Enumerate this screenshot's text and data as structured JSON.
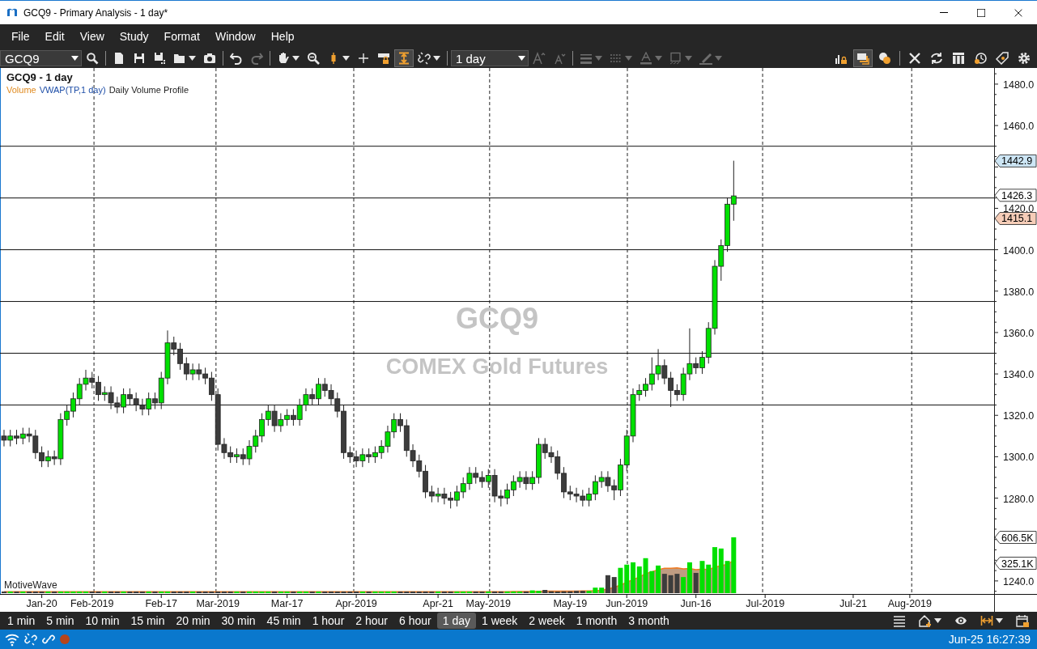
{
  "window": {
    "title": "GCQ9 - Primary Analysis - 1 day*"
  },
  "menu": [
    "File",
    "Edit",
    "View",
    "Study",
    "Format",
    "Window",
    "Help"
  ],
  "toolbar": {
    "left": [
      {
        "kind": "combo",
        "value": "GCQ9"
      },
      {
        "kind": "button",
        "selected": false,
        "disabled": false,
        "dropdown": false
      },
      {
        "kind": "separator"
      },
      {
        "kind": "button",
        "selected": false,
        "disabled": false,
        "dropdown": false
      },
      {
        "kind": "button",
        "selected": false,
        "disabled": false,
        "dropdown": false
      },
      {
        "kind": "button",
        "selected": false,
        "disabled": false,
        "dropdown": false
      },
      {
        "kind": "button",
        "selected": false,
        "disabled": false,
        "dropdown": true
      },
      {
        "kind": "button",
        "selected": false,
        "disabled": false,
        "dropdown": false
      },
      {
        "kind": "separator"
      },
      {
        "kind": "button",
        "selected": false,
        "disabled": false,
        "dropdown": false
      },
      {
        "kind": "button",
        "selected": false,
        "disabled": true,
        "dropdown": false
      },
      {
        "kind": "separator"
      },
      {
        "kind": "button",
        "selected": false,
        "disabled": false,
        "dropdown": true
      },
      {
        "kind": "button",
        "selected": false,
        "disabled": false,
        "dropdown": false
      },
      {
        "kind": "button",
        "selected": false,
        "disabled": false,
        "dropdown": true
      },
      {
        "kind": "button",
        "selected": false,
        "disabled": false,
        "dropdown": false
      },
      {
        "kind": "button",
        "selected": false,
        "disabled": false,
        "dropdown": false
      },
      {
        "kind": "button",
        "selected": true,
        "disabled": false,
        "dropdown": false
      },
      {
        "kind": "button",
        "selected": false,
        "disabled": false,
        "dropdown": true
      },
      {
        "kind": "separator"
      },
      {
        "kind": "combo",
        "value": "1 day"
      },
      {
        "kind": "button",
        "selected": false,
        "disabled": true,
        "dropdown": false
      },
      {
        "kind": "button",
        "selected": false,
        "disabled": true,
        "dropdown": false
      },
      {
        "kind": "separator"
      },
      {
        "kind": "button",
        "selected": false,
        "disabled": true,
        "dropdown": true
      },
      {
        "kind": "button",
        "selected": false,
        "disabled": true,
        "dropdown": true
      },
      {
        "kind": "button",
        "selected": false,
        "disabled": true,
        "dropdown": true
      },
      {
        "kind": "button",
        "selected": false,
        "disabled": true,
        "dropdown": true
      },
      {
        "kind": "button",
        "selected": false,
        "disabled": true,
        "dropdown": true
      }
    ],
    "right": [
      {
        "kind": "button",
        "selected": false,
        "disabled": false,
        "dropdown": false
      },
      {
        "kind": "button",
        "selected": true,
        "disabled": false,
        "dropdown": false
      },
      {
        "kind": "button",
        "selected": false,
        "disabled": false,
        "dropdown": false
      },
      {
        "kind": "separator"
      },
      {
        "kind": "button",
        "selected": false,
        "disabled": false,
        "dropdown": false
      },
      {
        "kind": "button",
        "selected": false,
        "disabled": false,
        "dropdown": false
      },
      {
        "kind": "button",
        "selected": false,
        "disabled": false,
        "dropdown": false
      },
      {
        "kind": "button",
        "selected": false,
        "disabled": false,
        "dropdown": false
      },
      {
        "kind": "button",
        "selected": false,
        "disabled": false,
        "dropdown": false
      },
      {
        "kind": "button",
        "selected": false,
        "disabled": false,
        "dropdown": false
      }
    ]
  },
  "chart": {
    "title": "GCQ9 - 1 day",
    "legend": [
      {
        "label": "Volume",
        "color": "#e08a1e"
      },
      {
        "label": "VWAP(TP,1 day)",
        "color": "#1f4fa8"
      },
      {
        "label": "Daily Volume Profile",
        "color": "#222222"
      }
    ],
    "watermark": {
      "symbol": "GCQ9",
      "name": "COMEX Gold Futures"
    },
    "brand": "MotiveWave",
    "chart_data": {
      "type": "candlestick",
      "ylim": [
        1233.7,
        1487.8
      ],
      "categories": [
        null,
        null,
        null,
        null,
        null,
        null,
        "Jan-20",
        null,
        null,
        null,
        null,
        null,
        null,
        null,
        "Feb-2019",
        null,
        null,
        null,
        null,
        null,
        null,
        null,
        null,
        null,
        null,
        "Feb-17",
        null,
        null,
        null,
        null,
        null,
        null,
        null,
        null,
        "Mar-2019",
        null,
        null,
        null,
        null,
        null,
        null,
        null,
        null,
        null,
        null,
        "Mar-17",
        null,
        null,
        null,
        null,
        null,
        null,
        null,
        null,
        null,
        null,
        "Apr-2019",
        null,
        null,
        null,
        null,
        null,
        null,
        null,
        null,
        null,
        null,
        null,
        null,
        "Apr-21",
        null,
        null,
        null,
        null,
        null,
        null,
        null,
        "May-2019",
        null,
        null,
        null,
        null,
        null,
        null,
        null,
        null,
        null,
        null,
        null,
        null,
        "May-19",
        null,
        null,
        null,
        null,
        null,
        null,
        null,
        null,
        "Jun-2019",
        null,
        null,
        null,
        null,
        null,
        null,
        null,
        null,
        null,
        null,
        "Jun-16",
        null,
        null,
        null,
        null,
        null,
        null,
        null,
        null,
        null,
        null,
        "Jul-2019",
        null,
        null,
        null,
        null,
        null,
        null,
        null,
        null,
        null,
        null,
        null,
        null,
        null,
        "Jul-21",
        null,
        null,
        null,
        null,
        null,
        null,
        null,
        null,
        "Aug-2019",
        null,
        null,
        null,
        null,
        null,
        null,
        null,
        null,
        null,
        null,
        null,
        null,
        null
      ],
      "ohlc": [
        [
          1310,
          1313,
          1305,
          1308
        ],
        [
          1308,
          1313,
          1305,
          1310
        ],
        [
          1310,
          1313,
          1306,
          1309
        ],
        [
          1309,
          1314,
          1306,
          1311
        ],
        [
          1311,
          1314,
          1307,
          1310
        ],
        [
          1310,
          1313,
          1299,
          1302
        ],
        [
          1302,
          1305,
          1295,
          1298
        ],
        [
          1298,
          1303,
          1295,
          1300
        ],
        [
          1300,
          1303,
          1296,
          1299
        ],
        [
          1299,
          1321,
          1296,
          1318
        ],
        [
          1318,
          1325,
          1315,
          1322
        ],
        [
          1322,
          1331,
          1319,
          1328
        ],
        [
          1328,
          1338,
          1325,
          1335
        ],
        [
          1335,
          1342,
          1332,
          1338
        ],
        [
          1338,
          1341,
          1333,
          1336
        ],
        [
          1336,
          1339,
          1327,
          1330
        ],
        [
          1330,
          1334,
          1327,
          1331
        ],
        [
          1331,
          1334,
          1323,
          1326
        ],
        [
          1326,
          1329,
          1321,
          1324
        ],
        [
          1324,
          1333,
          1321,
          1330
        ],
        [
          1330,
          1333,
          1325,
          1328
        ],
        [
          1328,
          1331,
          1322,
          1325
        ],
        [
          1325,
          1328,
          1320,
          1323
        ],
        [
          1323,
          1331,
          1320,
          1328
        ],
        [
          1328,
          1331,
          1323,
          1326
        ],
        [
          1326,
          1341,
          1323,
          1338
        ],
        [
          1338,
          1361,
          1335,
          1355
        ],
        [
          1355,
          1358,
          1349,
          1352
        ],
        [
          1352,
          1355,
          1342,
          1345
        ],
        [
          1345,
          1348,
          1337,
          1340
        ],
        [
          1340,
          1345,
          1337,
          1342
        ],
        [
          1342,
          1345,
          1337,
          1340
        ],
        [
          1340,
          1343,
          1335,
          1338
        ],
        [
          1338,
          1341,
          1327,
          1330
        ],
        [
          1330,
          1333,
          1303,
          1306
        ],
        [
          1306,
          1309,
          1299,
          1302
        ],
        [
          1302,
          1305,
          1297,
          1300
        ],
        [
          1300,
          1304,
          1297,
          1301
        ],
        [
          1301,
          1304,
          1296,
          1299
        ],
        [
          1299,
          1308,
          1296,
          1305
        ],
        [
          1305,
          1313,
          1302,
          1310
        ],
        [
          1310,
          1321,
          1307,
          1318
        ],
        [
          1318,
          1325,
          1315,
          1322
        ],
        [
          1322,
          1325,
          1312,
          1315
        ],
        [
          1315,
          1321,
          1312,
          1318
        ],
        [
          1318,
          1323,
          1315,
          1320
        ],
        [
          1320,
          1323,
          1315,
          1318
        ],
        [
          1318,
          1328,
          1315,
          1325
        ],
        [
          1325,
          1333,
          1322,
          1330
        ],
        [
          1330,
          1333,
          1325,
          1328
        ],
        [
          1328,
          1338,
          1325,
          1335
        ],
        [
          1335,
          1338,
          1329,
          1332
        ],
        [
          1332,
          1335,
          1325,
          1328
        ],
        [
          1328,
          1331,
          1319,
          1322
        ],
        [
          1322,
          1325,
          1299,
          1302
        ],
        [
          1302,
          1305,
          1297,
          1300
        ],
        [
          1300,
          1303,
          1295,
          1298
        ],
        [
          1298,
          1304,
          1295,
          1301
        ],
        [
          1301,
          1304,
          1297,
          1300
        ],
        [
          1300,
          1305,
          1297,
          1302
        ],
        [
          1302,
          1308,
          1299,
          1305
        ],
        [
          1305,
          1315,
          1302,
          1312
        ],
        [
          1312,
          1321,
          1309,
          1318
        ],
        [
          1318,
          1321,
          1312,
          1315
        ],
        [
          1315,
          1318,
          1300,
          1303
        ],
        [
          1303,
          1306,
          1295,
          1298
        ],
        [
          1298,
          1301,
          1290,
          1293
        ],
        [
          1293,
          1296,
          1280,
          1283
        ],
        [
          1283,
          1286,
          1278,
          1281
        ],
        [
          1281,
          1285,
          1278,
          1282
        ],
        [
          1282,
          1285,
          1277,
          1280
        ],
        [
          1280,
          1283,
          1275,
          1279
        ],
        [
          1279,
          1286,
          1276,
          1283
        ],
        [
          1283,
          1290,
          1280,
          1287
        ],
        [
          1287,
          1295,
          1284,
          1292
        ],
        [
          1292,
          1295,
          1287,
          1290
        ],
        [
          1290,
          1293,
          1285,
          1288
        ],
        [
          1288,
          1294,
          1285,
          1291
        ],
        [
          1291,
          1294,
          1278,
          1281
        ],
        [
          1281,
          1284,
          1276,
          1280
        ],
        [
          1280,
          1287,
          1277,
          1284
        ],
        [
          1284,
          1291,
          1281,
          1288
        ],
        [
          1288,
          1293,
          1285,
          1290
        ],
        [
          1290,
          1293,
          1284,
          1287
        ],
        [
          1287,
          1293,
          1284,
          1290
        ],
        [
          1290,
          1309,
          1287,
          1306
        ],
        [
          1306,
          1309,
          1299,
          1302
        ],
        [
          1302,
          1305,
          1297,
          1300
        ],
        [
          1300,
          1303,
          1289,
          1292
        ],
        [
          1292,
          1295,
          1280,
          1283
        ],
        [
          1283,
          1286,
          1279,
          1282
        ],
        [
          1282,
          1285,
          1278,
          1281
        ],
        [
          1281,
          1284,
          1276,
          1279
        ],
        [
          1279,
          1285,
          1276,
          1282
        ],
        [
          1282,
          1291,
          1279,
          1288
        ],
        [
          1288,
          1293,
          1285,
          1290
        ],
        [
          1290,
          1293,
          1283,
          1286
        ],
        [
          1286,
          1289,
          1279,
          1284
        ],
        [
          1284,
          1299,
          1281,
          1296
        ],
        [
          1296,
          1313,
          1293,
          1310
        ],
        [
          1310,
          1333,
          1307,
          1330
        ],
        [
          1330,
          1335,
          1327,
          1332
        ],
        [
          1332,
          1338,
          1329,
          1335
        ],
        [
          1335,
          1348,
          1332,
          1340
        ],
        [
          1340,
          1352,
          1337,
          1344
        ],
        [
          1344,
          1347,
          1335,
          1338
        ],
        [
          1338,
          1341,
          1324,
          1332
        ],
        [
          1332,
          1335,
          1327,
          1330
        ],
        [
          1330,
          1343,
          1327,
          1340
        ],
        [
          1340,
          1362,
          1337,
          1345
        ],
        [
          1345,
          1348,
          1340,
          1343
        ],
        [
          1343,
          1351,
          1340,
          1348
        ],
        [
          1348,
          1365,
          1345,
          1362
        ],
        [
          1362,
          1395,
          1359,
          1392
        ],
        [
          1392,
          1405,
          1385,
          1402
        ],
        [
          1402,
          1425,
          1399,
          1422
        ],
        [
          1422,
          1443,
          1414,
          1426
        ],
        null,
        null,
        null,
        null,
        null,
        null,
        null,
        null,
        null,
        null,
        null,
        null,
        null,
        null,
        null,
        null,
        null,
        null,
        null,
        null,
        null,
        null,
        null,
        null,
        null,
        null,
        null,
        null,
        null,
        null,
        null,
        null,
        null,
        null,
        null,
        null,
        null,
        null,
        null,
        null,
        null
      ],
      "yticks": [
        {
          "value": 1240,
          "label": "1240.0"
        },
        {
          "value": 1280,
          "label": "1280.0"
        },
        {
          "value": 1300,
          "label": "1300.0"
        },
        {
          "value": 1320,
          "label": "1320.0"
        },
        {
          "value": 1340,
          "label": "1340.0"
        },
        {
          "value": 1360,
          "label": "1360.0"
        },
        {
          "value": 1380,
          "label": "1380.0"
        },
        {
          "value": 1400,
          "label": "1400.0"
        },
        {
          "value": 1420,
          "label": "1420.0"
        },
        {
          "value": 1460,
          "label": "1460.0"
        },
        {
          "value": 1480,
          "label": "1480.0"
        }
      ],
      "ref_lines": [
        {
          "axis": "y",
          "value": 1450
        },
        {
          "axis": "y",
          "value": 1425
        },
        {
          "axis": "y",
          "value": 1400
        },
        {
          "axis": "y",
          "value": 1375
        },
        {
          "axis": "y",
          "value": 1350
        },
        {
          "axis": "y",
          "value": 1325
        }
      ]
    },
    "price_tags": [
      {
        "text": "1442.9",
        "color": "#cde6f5"
      },
      {
        "text": "1426.3",
        "color": "#ffffff"
      },
      {
        "text": "1415.1",
        "color": "#f6cdb8"
      }
    ],
    "volume": {
      "tags": [
        "606.5K",
        "325.1K"
      ]
    }
  },
  "timeframes": [
    {
      "label": "1 min",
      "selected": false
    },
    {
      "label": "5 min",
      "selected": false
    },
    {
      "label": "10 min",
      "selected": false
    },
    {
      "label": "15 min",
      "selected": false
    },
    {
      "label": "20 min",
      "selected": false
    },
    {
      "label": "30 min",
      "selected": false
    },
    {
      "label": "45 min",
      "selected": false
    },
    {
      "label": "1 hour",
      "selected": false
    },
    {
      "label": "2 hour",
      "selected": false
    },
    {
      "label": "6 hour",
      "selected": false
    },
    {
      "label": "1 day",
      "selected": true
    },
    {
      "label": "1 week",
      "selected": false
    },
    {
      "label": "2 week",
      "selected": false
    },
    {
      "label": "1 month",
      "selected": false
    },
    {
      "label": "3 month",
      "selected": false
    }
  ],
  "status_bar": {
    "connection": {
      "color": "#b5441b"
    },
    "time": "Jun-25 16:27:39"
  }
}
